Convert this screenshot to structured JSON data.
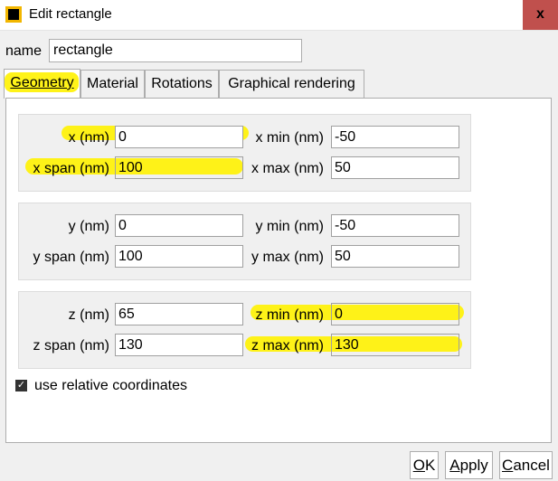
{
  "window": {
    "title": "Edit rectangle",
    "close_glyph": "x"
  },
  "name_row": {
    "label": "name",
    "value": "rectangle"
  },
  "tabs": [
    {
      "label": "Geometry",
      "active": true
    },
    {
      "label": "Material",
      "active": false
    },
    {
      "label": "Rotations",
      "active": false
    },
    {
      "label": "Graphical rendering",
      "active": false
    }
  ],
  "geometry": {
    "x": {
      "label": "x (nm)",
      "value": "0"
    },
    "x_span": {
      "label": "x span (nm)",
      "value": "100"
    },
    "x_min": {
      "label": "x min (nm)",
      "value": "-50"
    },
    "x_max": {
      "label": "x max (nm)",
      "value": "50"
    },
    "y": {
      "label": "y (nm)",
      "value": "0"
    },
    "y_span": {
      "label": "y span (nm)",
      "value": "100"
    },
    "y_min": {
      "label": "y min (nm)",
      "value": "-50"
    },
    "y_max": {
      "label": "y max (nm)",
      "value": "50"
    },
    "z": {
      "label": "z (nm)",
      "value": "65"
    },
    "z_span": {
      "label": "z span (nm)",
      "value": "130"
    },
    "z_min": {
      "label": "z min (nm)",
      "value": "0"
    },
    "z_max": {
      "label": "z max (nm)",
      "value": "130"
    }
  },
  "relative_coords": {
    "label": "use relative coordinates",
    "checked": true
  },
  "buttons": {
    "ok": "OK",
    "apply": "Apply",
    "cancel": "Cancel"
  },
  "colors": {
    "highlight": "#fff200",
    "close_bg": "#c0504d",
    "active_tab": "#b8d7f2"
  }
}
